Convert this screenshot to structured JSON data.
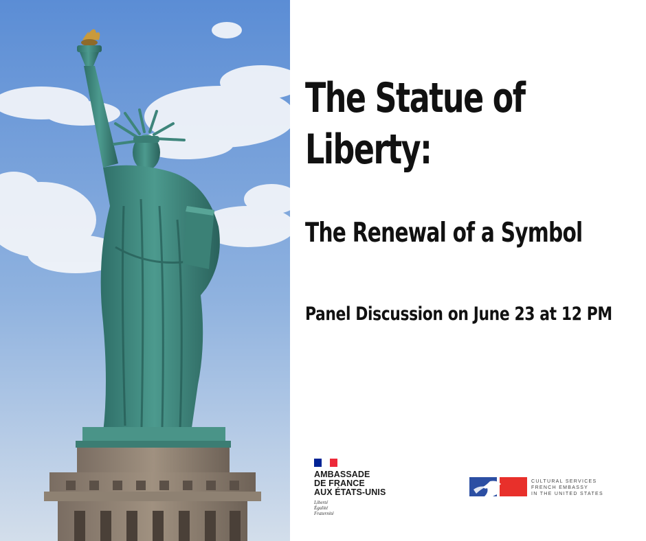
{
  "poster": {
    "title_line1": "The Statue of",
    "title_line2": "Liberty:",
    "subtitle": "The Renewal of a Symbol",
    "event": "Panel Discussion on June 23 at 12 PM"
  },
  "photo": {
    "subject": "statue-of-liberty-photo",
    "sky_top": "#5c8ed6",
    "sky_bottom": "#cfdcea",
    "statue_color": "#3f8a80",
    "pedestal_color": "#8a7d70"
  },
  "logos": {
    "embassy": {
      "lines": [
        "AMBASSADE",
        "DE FRANCE",
        "AUX ÉTATS-UNIS"
      ],
      "motto": [
        "Liberté",
        "Égalité",
        "Fraternité"
      ],
      "flag_colors": [
        "#002395",
        "#ffffff",
        "#ed2939"
      ]
    },
    "cultural_services": {
      "lines": [
        "CULTURAL SERVICES",
        "FRENCH EMBASSY",
        "IN THE UNITED STATES"
      ],
      "colors": [
        "#2c4fa3",
        "#e8302b"
      ]
    }
  }
}
